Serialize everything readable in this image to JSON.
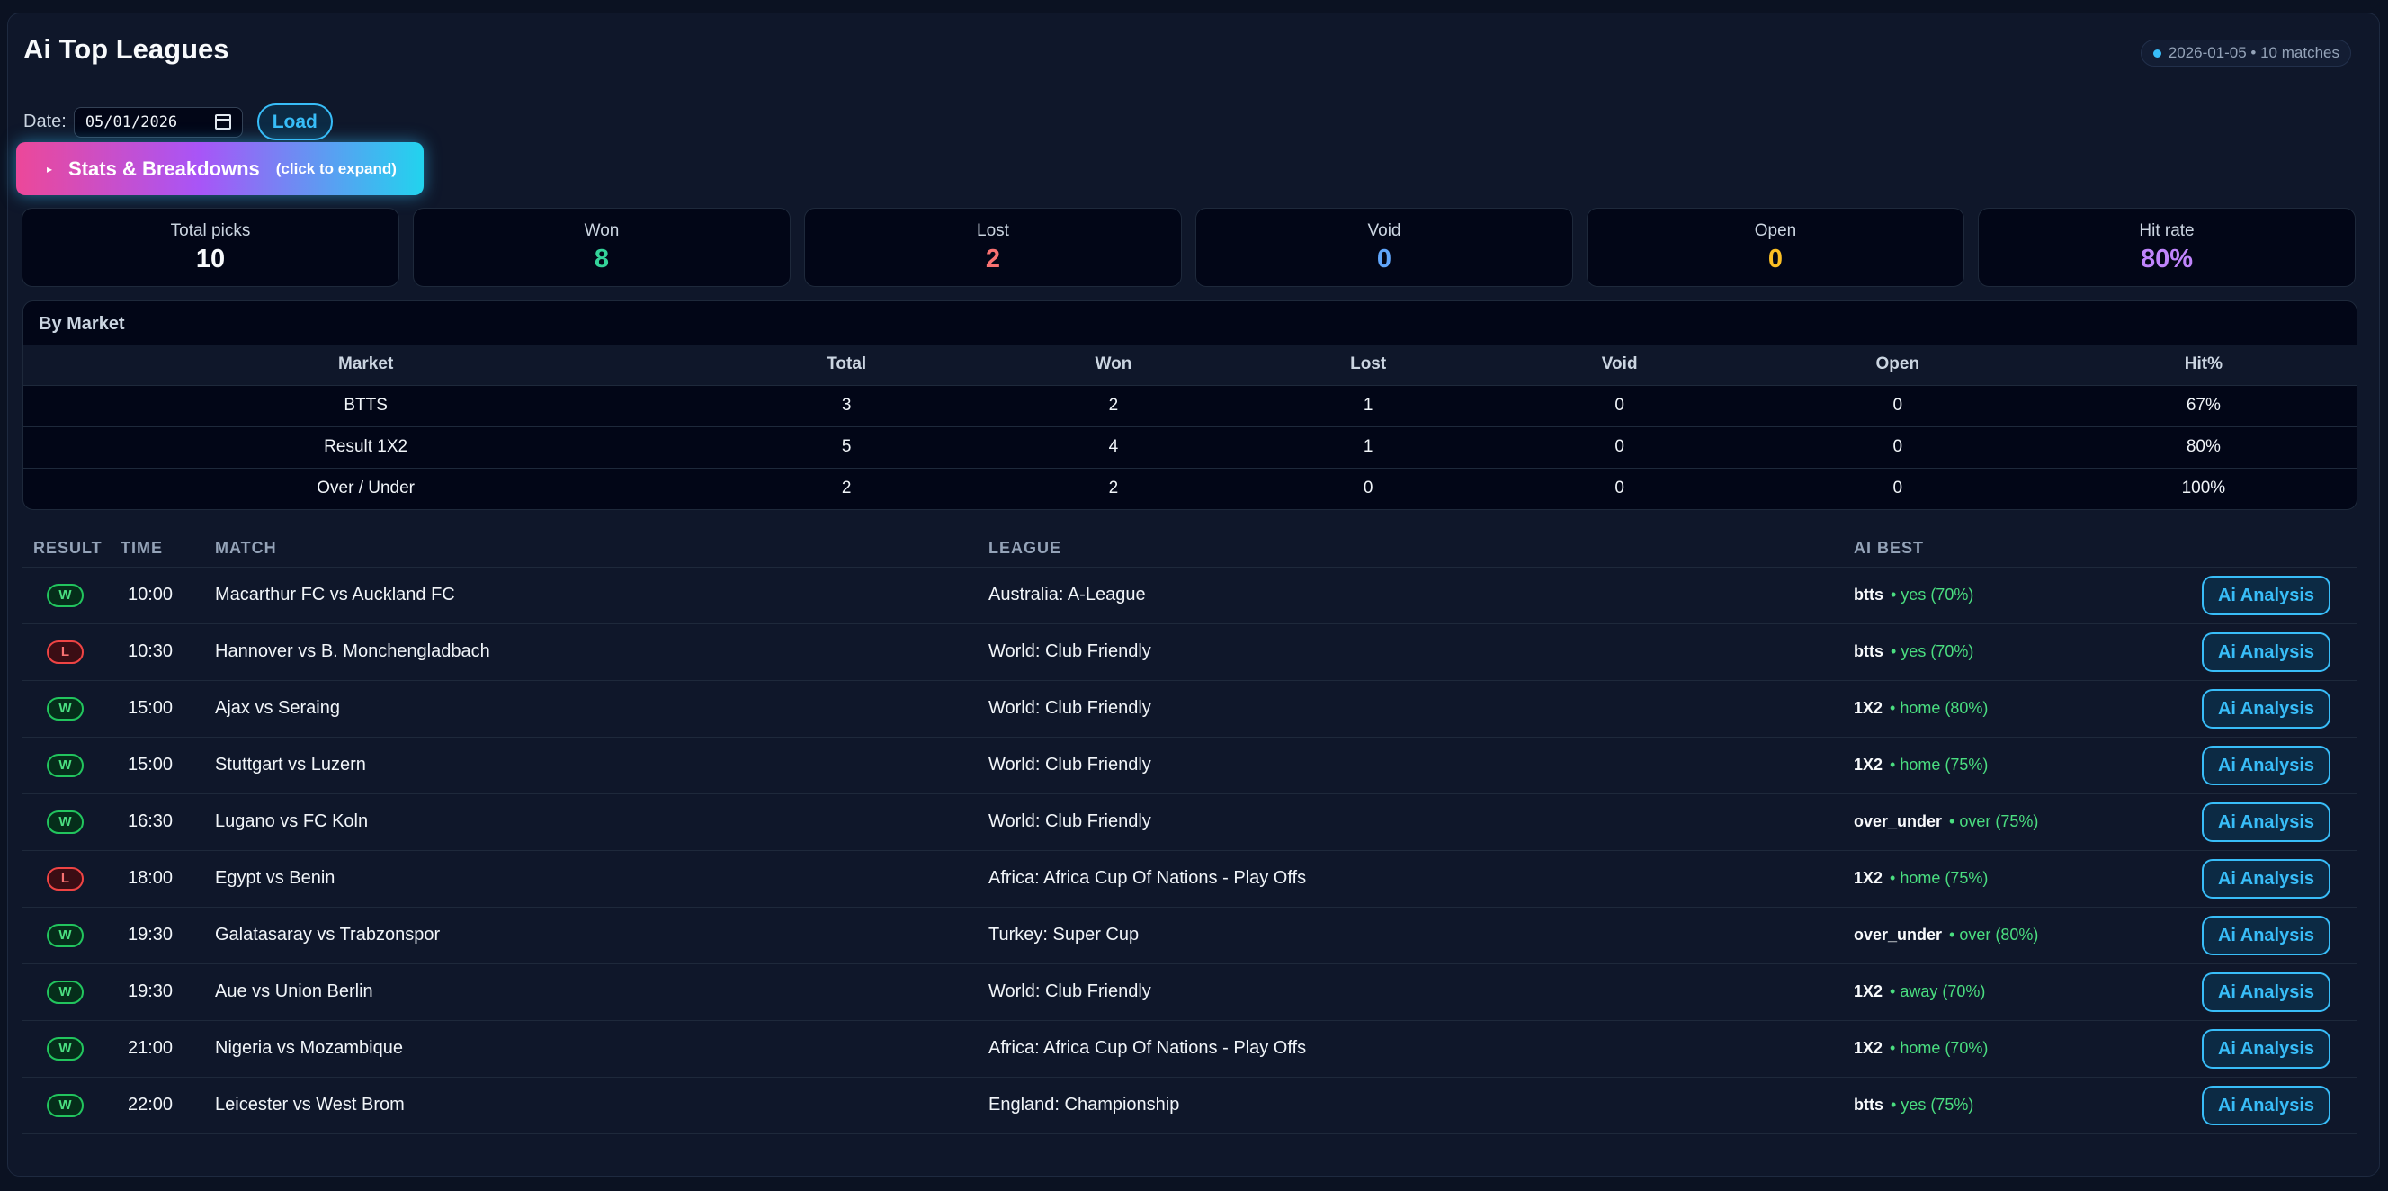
{
  "header": {
    "title": "Ai Top Leagues",
    "badge": "2026-01-05 • 10 matches"
  },
  "date": {
    "label": "Date:",
    "value": "05/01/2026",
    "load_label": "Load"
  },
  "stats_toggle": {
    "icon": "▸",
    "label": "Stats & Breakdowns",
    "hint": "(click to expand)"
  },
  "summary": [
    {
      "label": "Total picks",
      "value": "10",
      "color": "#f8fafc"
    },
    {
      "label": "Won",
      "value": "8",
      "color": "#34d399"
    },
    {
      "label": "Lost",
      "value": "2",
      "color": "#f87171"
    },
    {
      "label": "Void",
      "value": "0",
      "color": "#60a5fa"
    },
    {
      "label": "Open",
      "value": "0",
      "color": "#fbbf24"
    },
    {
      "label": "Hit rate",
      "value": "80%",
      "color": "#c084fc"
    }
  ],
  "by_market": {
    "title": "By Market",
    "columns": [
      "Market",
      "Total",
      "Won",
      "Lost",
      "Void",
      "Open",
      "Hit%"
    ],
    "rows": [
      [
        "BTTS",
        "3",
        "2",
        "1",
        "0",
        "0",
        "67%"
      ],
      [
        "Result 1X2",
        "5",
        "4",
        "1",
        "0",
        "0",
        "80%"
      ],
      [
        "Over / Under",
        "2",
        "2",
        "0",
        "0",
        "0",
        "100%"
      ]
    ]
  },
  "matches": {
    "columns": [
      "RESULT",
      "TIME",
      "MATCH",
      "LEAGUE",
      "AI BEST",
      ""
    ],
    "rows": [
      {
        "result": "W",
        "time": "10:00",
        "match": "Macarthur FC  vs  Auckland FC",
        "league": "Australia: A-League",
        "market": "btts",
        "pick": "• yes (70%)",
        "action": "Ai Analysis"
      },
      {
        "result": "L",
        "time": "10:30",
        "match": "Hannover  vs  B. Monchengladbach",
        "league": "World: Club Friendly",
        "market": "btts",
        "pick": "• yes (70%)",
        "action": "Ai Analysis"
      },
      {
        "result": "W",
        "time": "15:00",
        "match": "Ajax  vs  Seraing",
        "league": "World: Club Friendly",
        "market": "1X2",
        "pick": "• home (80%)",
        "action": "Ai Analysis"
      },
      {
        "result": "W",
        "time": "15:00",
        "match": "Stuttgart  vs  Luzern",
        "league": "World: Club Friendly",
        "market": "1X2",
        "pick": "• home (75%)",
        "action": "Ai Analysis"
      },
      {
        "result": "W",
        "time": "16:30",
        "match": "Lugano  vs  FC Koln",
        "league": "World: Club Friendly",
        "market": "over_under",
        "pick": "• over (75%)",
        "action": "Ai Analysis"
      },
      {
        "result": "L",
        "time": "18:00",
        "match": "Egypt  vs  Benin",
        "league": "Africa: Africa Cup Of Nations - Play Offs",
        "market": "1X2",
        "pick": "• home (75%)",
        "action": "Ai Analysis"
      },
      {
        "result": "W",
        "time": "19:30",
        "match": "Galatasaray  vs  Trabzonspor",
        "league": "Turkey: Super Cup",
        "market": "over_under",
        "pick": "• over (80%)",
        "action": "Ai Analysis"
      },
      {
        "result": "W",
        "time": "19:30",
        "match": "Aue  vs  Union Berlin",
        "league": "World: Club Friendly",
        "market": "1X2",
        "pick": "• away (70%)",
        "action": "Ai Analysis"
      },
      {
        "result": "W",
        "time": "21:00",
        "match": "Nigeria  vs  Mozambique",
        "league": "Africa: Africa Cup Of Nations - Play Offs",
        "market": "1X2",
        "pick": "• home (70%)",
        "action": "Ai Analysis"
      },
      {
        "result": "W",
        "time": "22:00",
        "match": "Leicester  vs  West Brom",
        "league": "England: Championship",
        "market": "btts",
        "pick": "• yes (75%)",
        "action": "Ai Analysis"
      }
    ]
  }
}
